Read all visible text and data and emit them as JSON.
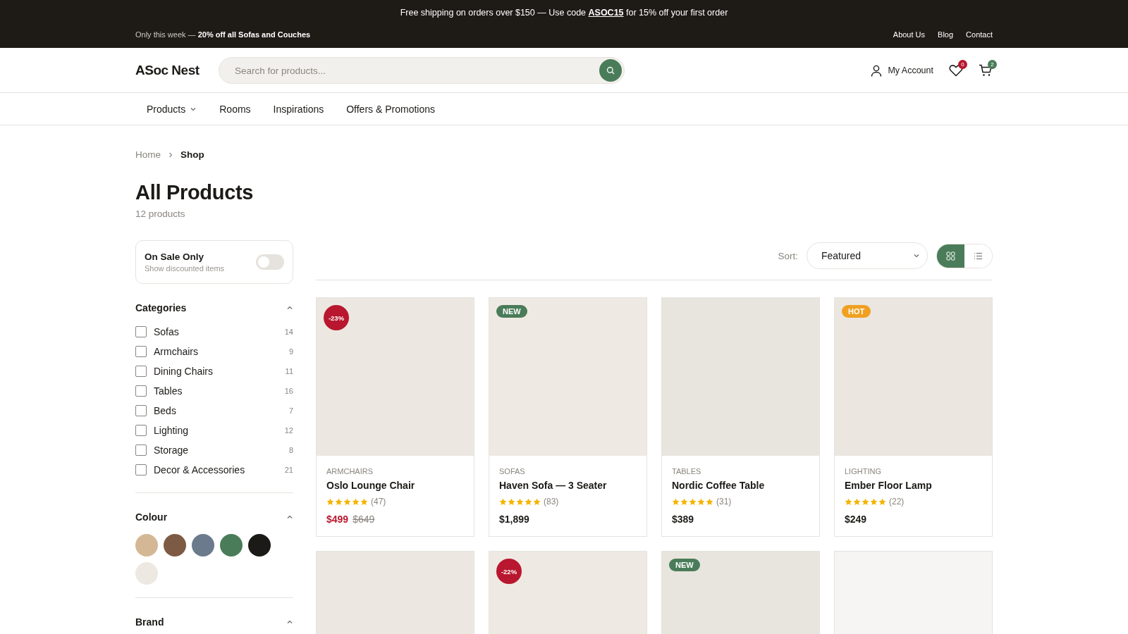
{
  "announcement": {
    "text": "Free shipping on orders over $150 — Use code ",
    "code": "ASOC15",
    "after": " for 15% off your first order"
  },
  "promo": "Only this week — **20% off all Sofas and Couches**",
  "top_links": [
    "About Us",
    "Blog",
    "Contact"
  ],
  "logo": "ASoc Nest",
  "search": {
    "placeholder": "Search for products..."
  },
  "account": "My Account",
  "wishlist_count": "0",
  "cart_count": "2",
  "nav": [
    {
      "label": "Products",
      "dropdown": true
    },
    {
      "label": "Rooms",
      "dropdown": false
    },
    {
      "label": "Inspirations",
      "dropdown": false
    },
    {
      "label": "Offers & Promotions",
      "dropdown": false
    }
  ],
  "breadcrumb": [
    "Home",
    "Shop"
  ],
  "page_title": "All Products",
  "product_count": "12 products",
  "sale_toggle": {
    "title": "On Sale Only",
    "subtitle": "Show discounted items",
    "on": false
  },
  "categories": {
    "title": "Categories",
    "expanded": true,
    "items": [
      {
        "label": "Sofas",
        "count": "14",
        "checked": false
      },
      {
        "label": "Armchairs",
        "count": "9",
        "checked": false
      },
      {
        "label": "Dining Chairs",
        "count": "11",
        "checked": false
      },
      {
        "label": "Tables",
        "count": "16",
        "checked": false
      },
      {
        "label": "Beds",
        "count": "7",
        "checked": false
      },
      {
        "label": "Lighting",
        "count": "12",
        "checked": false
      },
      {
        "label": "Storage",
        "count": "8",
        "checked": false
      },
      {
        "label": "Decor & Accessories",
        "count": "21",
        "checked": false
      }
    ]
  },
  "colour": {
    "title": "Colour",
    "expanded": true,
    "swatches": [
      {
        "color": "#d4b896"
      },
      {
        "color": "#7d5a44"
      },
      {
        "color": "#6b7a8c"
      },
      {
        "color": "#4a7c59"
      },
      {
        "color": "#1c1a17"
      },
      {
        "color": "#ede9e2"
      }
    ]
  },
  "brand": {
    "title": "Brand",
    "expanded": true
  },
  "sort": {
    "label": "Sort:",
    "value": "Featured"
  },
  "view": [
    {
      "kind": "grid",
      "selected": true
    },
    {
      "kind": "list",
      "selected": false
    }
  ],
  "products": [
    {
      "badge": {
        "kind": "sale",
        "text": "-23%"
      },
      "category": "ARMCHAIRS",
      "name": "Oslo Lounge Chair",
      "stars": 5,
      "reviews": "(47)",
      "price": "$499",
      "old_price": "$649"
    },
    {
      "badge": {
        "kind": "new",
        "text": "NEW"
      },
      "category": "SOFAS",
      "name": "Haven Sofa — 3 Seater",
      "stars": 5,
      "reviews": "(83)",
      "price": "$1,899"
    },
    {
      "category": "TABLES",
      "name": "Nordic Coffee Table",
      "stars": 5,
      "reviews": "(31)",
      "price": "$389"
    },
    {
      "badge": {
        "kind": "hot",
        "text": "HOT"
      },
      "category": "LIGHTING",
      "name": "Ember Floor Lamp",
      "stars": 5,
      "reviews": "(22)",
      "price": "$249"
    },
    {
      "kind": "blank"
    },
    {
      "badge": {
        "kind": "sale",
        "text": "-22%"
      }
    },
    {
      "badge": {
        "kind": "new",
        "text": "NEW"
      }
    },
    {
      "kind": "blank"
    }
  ]
}
